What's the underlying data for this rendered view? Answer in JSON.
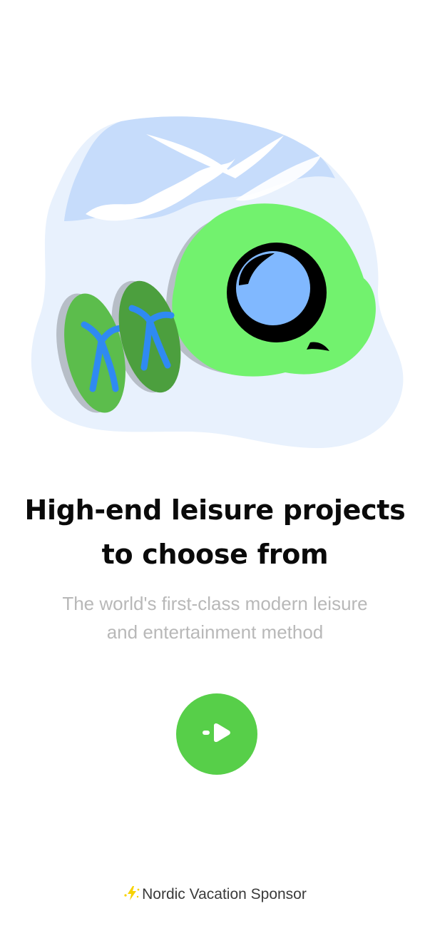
{
  "hero": {
    "illustration": "beach-flip-flops-and-swim-ring-illustration",
    "colors": {
      "backdrop": "#e8f1fd",
      "sky": "#c6dcfb",
      "float": "#72f26e",
      "flipflop": "#5cbd4c",
      "strap": "#2f8af2",
      "shadow": "#b7bec7"
    }
  },
  "content": {
    "title_line1": "High-end leisure projects",
    "title_line2": "to choose from",
    "subtitle_line1": "The world's first-class modern leisure",
    "subtitle_line2": "and entertainment method"
  },
  "actions": {
    "next_icon": "arrow-right-icon",
    "accent": "#57cf49"
  },
  "footer": {
    "icon": "lightning-icon",
    "label": "Nordic Vacation Sponsor"
  }
}
